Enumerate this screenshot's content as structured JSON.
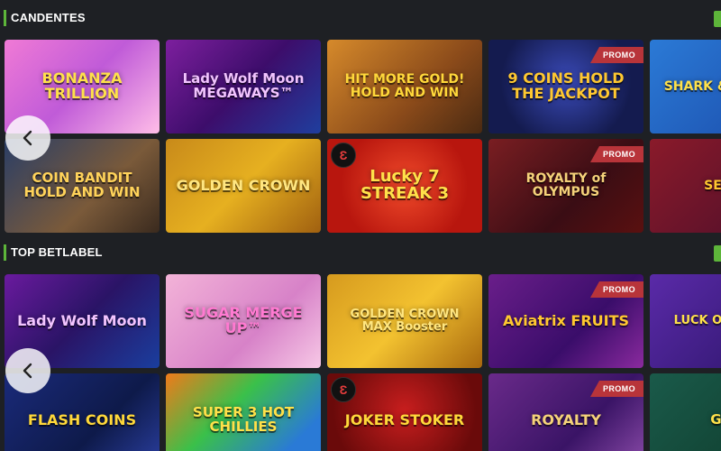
{
  "sections": [
    {
      "title": "CANDENTES",
      "tiles": [
        {
          "name": "BONANZA TRILLION",
          "promo": false,
          "provider": false,
          "bg": "linear-gradient(135deg,#f07ad6,#c05bd8 50%,#ffbde8)",
          "color": "#ffe14a",
          "size": "16px"
        },
        {
          "name": "Lady Wolf Moon MEGAWAYS™",
          "promo": false,
          "provider": false,
          "bg": "linear-gradient(135deg,#7d1f9e,#3d0d6b 50%,#1f3e9e)",
          "color": "#f2c4ff",
          "size": "15px"
        },
        {
          "name": "HIT MORE GOLD! HOLD AND WIN",
          "promo": false,
          "provider": false,
          "bg": "linear-gradient(135deg,#d68a2b,#8a4a1a 60%,#4a2a12)",
          "color": "#ffd83a",
          "size": "14px"
        },
        {
          "name": "9 COINS HOLD THE JACKPOT",
          "promo": true,
          "provider": false,
          "bg": "radial-gradient(circle at 50% 45%,#3a4ab8,#141b4f 70%)",
          "color": "#ffc830",
          "size": "16px"
        },
        {
          "name": "SHARK & SHARKS",
          "promo": false,
          "provider": false,
          "bg": "linear-gradient(135deg,#2b7ad6,#1a4aa8)",
          "color": "#ffe14a",
          "size": "14px"
        },
        {
          "name": "COIN BANDIT HOLD AND WIN",
          "promo": false,
          "provider": false,
          "bg": "linear-gradient(135deg,#2a3e66,#7a5a3a 60%,#3a2a1e)",
          "color": "#ffd35a",
          "size": "15px"
        },
        {
          "name": "GOLDEN CROWN",
          "promo": false,
          "provider": false,
          "bg": "linear-gradient(135deg,#c88a1a,#e6b020 50%,#a06010)",
          "color": "#ffe680",
          "size": "16px"
        },
        {
          "name": "Lucky 7 STREAK 3",
          "promo": false,
          "provider": true,
          "bg": "radial-gradient(circle at 50% 50%,#f04a2a,#b8160e 70%)",
          "color": "#ffe14a",
          "size": "18px"
        },
        {
          "name": "ROYALTY of OLYMPUS",
          "promo": true,
          "provider": false,
          "bg": "linear-gradient(135deg,#7a1e22,#3a0d14 60%,#5a1010)",
          "color": "#f5d27a",
          "size": "14px"
        },
        {
          "name": "SEVEN",
          "promo": false,
          "provider": false,
          "bg": "linear-gradient(135deg,#8a1a2a,#4a0e2a)",
          "color": "#ffc830",
          "size": "14px"
        }
      ]
    },
    {
      "title": "TOP BETLABEL",
      "tiles": [
        {
          "name": "Lady Wolf Moon",
          "promo": false,
          "provider": false,
          "bg": "linear-gradient(135deg,#6a1a9e,#2a1466 50%,#1a3e9e)",
          "color": "#f2c4ff",
          "size": "16px"
        },
        {
          "name": "SUGAR MERGE UP™",
          "promo": false,
          "provider": false,
          "bg": "linear-gradient(135deg,#f3b3d8,#d782c8 60%,#f7c8e6)",
          "color": "#ff7ad1",
          "size": "16px"
        },
        {
          "name": "GOLDEN CROWN MAX Booster",
          "promo": false,
          "provider": false,
          "bg": "linear-gradient(135deg,#d69a1e,#f3c230 50%,#a8680e)",
          "color": "#ffe680",
          "size": "13px"
        },
        {
          "name": "Aviatrix FRUITS",
          "promo": true,
          "provider": false,
          "bg": "linear-gradient(135deg,#6a1e8a,#3a0d6a 60%,#8a2a9e)",
          "color": "#ffc830",
          "size": "16px"
        },
        {
          "name": "LUCK OF BONUS",
          "promo": false,
          "provider": false,
          "bg": "linear-gradient(135deg,#5a2aa8,#2a1466)",
          "color": "#ffe14a",
          "size": "13px"
        },
        {
          "name": "FLASH COINS",
          "promo": false,
          "provider": false,
          "bg": "linear-gradient(135deg,#1a2a7a,#0e1a4a 60%,#2a3e9e)",
          "color": "#ffd83a",
          "size": "16px"
        },
        {
          "name": "SUPER 3 HOT CHILLIES",
          "promo": false,
          "provider": false,
          "bg": "linear-gradient(135deg,#f07a1a,#3ac04a 40%,#2a7ad6 80%)",
          "color": "#ffe14a",
          "size": "15px"
        },
        {
          "name": "JOKER STOKER",
          "promo": false,
          "provider": true,
          "bg": "radial-gradient(circle at 50% 40%,#c81e1e,#6a0a0a 75%)",
          "color": "#ffd83a",
          "size": "16px"
        },
        {
          "name": "ROYALTY",
          "promo": true,
          "provider": false,
          "bg": "linear-gradient(135deg,#6a2a8a,#3a1466 60%,#8a4aa8)",
          "color": "#f5d27a",
          "size": "16px"
        },
        {
          "name": "GEM",
          "promo": false,
          "provider": false,
          "bg": "linear-gradient(135deg,#1a5a4a,#0e3a2a)",
          "color": "#ffe14a",
          "size": "15px"
        }
      ]
    }
  ],
  "promo_label": "PROMO",
  "provider_glyph": "Ɛ",
  "icons": {
    "prev": "chevron-left-icon"
  }
}
